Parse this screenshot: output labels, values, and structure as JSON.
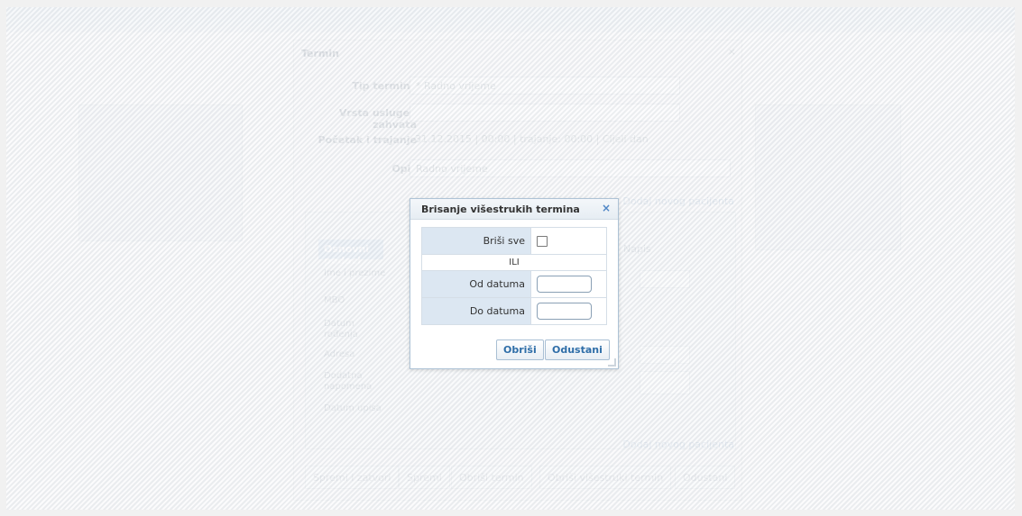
{
  "background_dialog": {
    "title": "Termin",
    "close": "×",
    "fields": [
      {
        "label": "Tip termina",
        "value": "* Radno vrijeme"
      },
      {
        "label": "Vrsta usluge / zahvata",
        "value": ""
      },
      {
        "label": "Početak i trajanje",
        "value": "31.12.2015 | 00:00 | trajanje: 00:00 | Cijeli dan"
      },
      {
        "label": "Opis",
        "value": "Radno vrijeme"
      }
    ],
    "tab_active": "Osnovni podaci",
    "tab_other": "Napis",
    "patient_labels": [
      "Ime i prezime",
      "MBO",
      "Datum rođenja",
      "Adresa",
      "Dodatna napomena",
      "Datum upisa"
    ],
    "add_patient_link": "Dodaj novog pacijenta",
    "buttons": [
      "Spremi i zatvori",
      "Spremi",
      "Obriši termin",
      "Obriši višestruki termin",
      "Odustani"
    ]
  },
  "modal": {
    "title": "Brisanje višestrukih termina",
    "close_icon": "×",
    "rows": {
      "delete_all_label": "Briši sve",
      "or_label": "ILI",
      "from_label": "Od datuma",
      "to_label": "Do datuma"
    },
    "from_value": "",
    "to_value": "",
    "delete_button": "Obriši",
    "cancel_button": "Odustani"
  }
}
